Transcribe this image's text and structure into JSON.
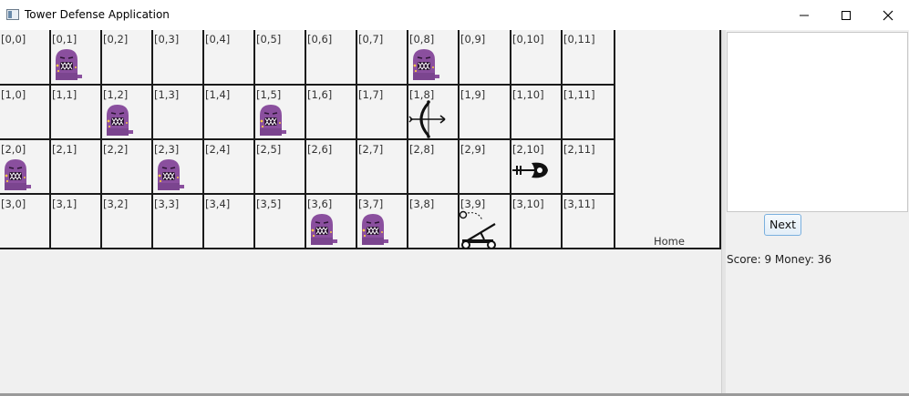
{
  "window": {
    "title": "Tower Defense Application",
    "icons": {
      "app": "app-window-icon",
      "minimize": "minimize-icon",
      "maximize": "maximize-icon",
      "close": "close-icon"
    }
  },
  "grid": {
    "rows": [
      {
        "cells": [
          {
            "label": "[0,0]",
            "occupant": null
          },
          {
            "label": "[0,1]",
            "occupant": "monster"
          },
          {
            "label": "[0,2]",
            "occupant": null
          },
          {
            "label": "[0,3]",
            "occupant": null
          },
          {
            "label": "[0,4]",
            "occupant": null
          },
          {
            "label": "[0,5]",
            "occupant": null
          },
          {
            "label": "[0,6]",
            "occupant": null
          },
          {
            "label": "[0,7]",
            "occupant": null
          },
          {
            "label": "[0,8]",
            "occupant": "monster"
          },
          {
            "label": "[0,9]",
            "occupant": null
          },
          {
            "label": "[0,10]",
            "occupant": null
          },
          {
            "label": "[0,11]",
            "occupant": null
          }
        ]
      },
      {
        "cells": [
          {
            "label": "[1,0]",
            "occupant": null
          },
          {
            "label": "[1,1]",
            "occupant": null
          },
          {
            "label": "[1,2]",
            "occupant": "monster"
          },
          {
            "label": "[1,3]",
            "occupant": null
          },
          {
            "label": "[1,4]",
            "occupant": null
          },
          {
            "label": "[1,5]",
            "occupant": "monster"
          },
          {
            "label": "[1,6]",
            "occupant": null
          },
          {
            "label": "[1,7]",
            "occupant": null
          },
          {
            "label": "[1,8]",
            "occupant": "archer-tower"
          },
          {
            "label": "[1,9]",
            "occupant": null
          },
          {
            "label": "[1,10]",
            "occupant": null
          },
          {
            "label": "[1,11]",
            "occupant": null
          }
        ]
      },
      {
        "cells": [
          {
            "label": "[2,0]",
            "occupant": "monster"
          },
          {
            "label": "[2,1]",
            "occupant": null
          },
          {
            "label": "[2,2]",
            "occupant": null
          },
          {
            "label": "[2,3]",
            "occupant": "monster"
          },
          {
            "label": "[2,4]",
            "occupant": null
          },
          {
            "label": "[2,5]",
            "occupant": null
          },
          {
            "label": "[2,6]",
            "occupant": null
          },
          {
            "label": "[2,7]",
            "occupant": null
          },
          {
            "label": "[2,8]",
            "occupant": null
          },
          {
            "label": "[2,9]",
            "occupant": null
          },
          {
            "label": "[2,10]",
            "occupant": "slingshot-tower"
          },
          {
            "label": "[2,11]",
            "occupant": null
          }
        ]
      },
      {
        "cells": [
          {
            "label": "[3,0]",
            "occupant": null
          },
          {
            "label": "[3,1]",
            "occupant": null
          },
          {
            "label": "[3,2]",
            "occupant": null
          },
          {
            "label": "[3,3]",
            "occupant": null
          },
          {
            "label": "[3,4]",
            "occupant": null
          },
          {
            "label": "[3,5]",
            "occupant": null
          },
          {
            "label": "[3,6]",
            "occupant": "monster"
          },
          {
            "label": "[3,7]",
            "occupant": "monster"
          },
          {
            "label": "[3,8]",
            "occupant": null
          },
          {
            "label": "[3,9]",
            "occupant": "catapult-tower"
          },
          {
            "label": "[3,10]",
            "occupant": null
          },
          {
            "label": "[3,11]",
            "occupant": null
          }
        ]
      }
    ],
    "home_label": "Home",
    "colors": {
      "monster_body": "#8a4f9e",
      "monster_dark": "#6c3b80",
      "cell_bg": "#f3f3f3",
      "grid_line": "#1a1a1a"
    }
  },
  "side_panel": {
    "next_label": "Next",
    "status_text": "Score: 9 Money: 36"
  }
}
